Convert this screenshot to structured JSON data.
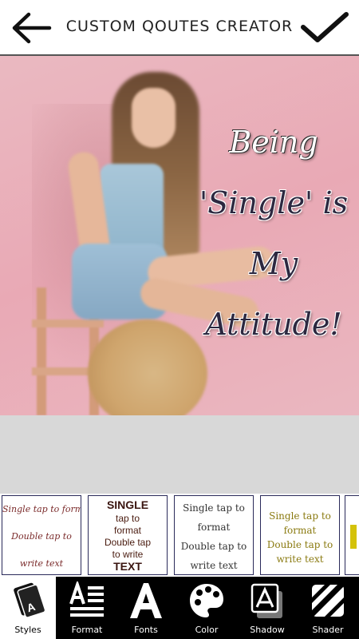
{
  "header": {
    "title": "CUSTOM QOUTES CREATOR",
    "back_icon": "arrow-left-icon",
    "done_icon": "checkmark-icon"
  },
  "canvas": {
    "background_color": "#e9a9b5",
    "quote_lines": [
      "Being",
      "'Single' is",
      "My",
      "Attitude!"
    ]
  },
  "style_cards": [
    {
      "lines": [
        "Single tap to format",
        "Double tap to",
        "write text"
      ]
    },
    {
      "lines": [
        "SINGLE",
        "tap to",
        "format",
        "Double tap",
        "to write",
        "TEXT"
      ]
    },
    {
      "lines": [
        "Single tap to",
        "format",
        "Double tap to",
        "write text"
      ]
    },
    {
      "lines": [
        "Single tap to",
        "format",
        "Double tap to",
        "write text"
      ]
    }
  ],
  "toolbar": {
    "items": [
      {
        "label": "Styles",
        "icon": "styles-icon",
        "active": true
      },
      {
        "label": "Format",
        "icon": "format-icon",
        "active": false
      },
      {
        "label": "Fonts",
        "icon": "fonts-icon",
        "active": false
      },
      {
        "label": "Color",
        "icon": "palette-icon",
        "active": false
      },
      {
        "label": "Shadow",
        "icon": "shadow-icon",
        "active": false
      },
      {
        "label": "Shader",
        "icon": "shader-icon",
        "active": false
      }
    ]
  }
}
